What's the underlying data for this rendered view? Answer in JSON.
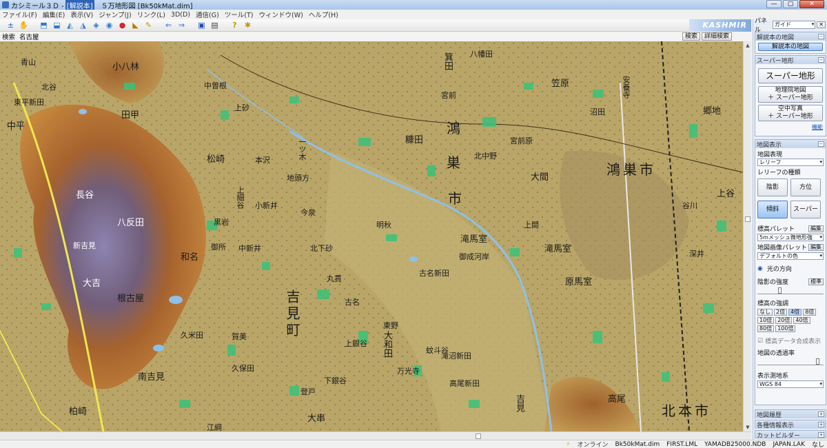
{
  "window": {
    "app_name": "カシミール３Ｄ -",
    "doc_tag": "[解説本]",
    "title_rest": "５万地形図 [Bk50kMat.dim]",
    "min": "—",
    "max": "▢",
    "close": "✕"
  },
  "menu": [
    "ファイル(F)",
    "編集(E)",
    "表示(V)",
    "ジャンプ(J)",
    "リンク(L)",
    "3D(D)",
    "通信(G)",
    "ツール(T)",
    "ウィンドウ(W)",
    "ヘルプ(H)"
  ],
  "toolbar": {
    "icons": [
      "jump-icon",
      "hand-icon",
      "open-icon",
      "save-icon",
      "map-a-icon",
      "map-b-icon",
      "map-c-icon",
      "map-d-icon",
      "pin-icon",
      "ruler-icon",
      "pencil-icon",
      "back-arrow-icon",
      "forward-arrow-icon",
      "gps-icon",
      "phone-icon",
      "help-icon",
      "star-icon"
    ],
    "glyphs": [
      "±",
      "✋",
      "⬒",
      "⬓",
      "◭",
      "◮",
      "◈",
      "◉",
      "●",
      "◣",
      "✎",
      "⇐",
      "⇒",
      "▣",
      "▤",
      "?",
      "✱"
    ],
    "brand": "KASHMIR 3D"
  },
  "search": {
    "label": "検索",
    "value": "名古屋",
    "button": "検索",
    "detail_button": "詳細検索"
  },
  "map": {
    "labels": [
      {
        "t": "青山",
        "c": "ml-sm"
      },
      {
        "t": "北谷",
        "c": "ml-sm"
      },
      {
        "t": "東平新田",
        "c": "ml-sm"
      },
      {
        "t": "中平",
        "c": "ml-md"
      },
      {
        "t": "小八林",
        "c": "ml-md"
      },
      {
        "t": "田甲",
        "c": "ml-md"
      },
      {
        "t": "松崎",
        "c": "ml-md"
      },
      {
        "t": "中曽根",
        "c": "ml-sm"
      },
      {
        "t": "上砂",
        "c": "ml-sm"
      },
      {
        "t": "本沢",
        "c": "ml-sm"
      },
      {
        "t": "一ツ木",
        "c": "ml-vert"
      },
      {
        "t": "地頭方",
        "c": "ml-sm"
      },
      {
        "t": "長谷",
        "c": "ml-md"
      },
      {
        "t": "八反田",
        "c": "ml-md"
      },
      {
        "t": "新吉見",
        "c": "ml-sm"
      },
      {
        "t": "上細谷",
        "c": "ml-vert"
      },
      {
        "t": "黒岩",
        "c": "ml-sm"
      },
      {
        "t": "小新井",
        "c": "ml-sm"
      },
      {
        "t": "今泉",
        "c": "ml-sm"
      },
      {
        "t": "御所",
        "c": "ml-sm"
      },
      {
        "t": "中新井",
        "c": "ml-sm"
      },
      {
        "t": "北下砂",
        "c": "ml-sm"
      },
      {
        "t": "吉見町",
        "c": "ml-lg"
      },
      {
        "t": "丸貫",
        "c": "ml-sm"
      },
      {
        "t": "明秋",
        "c": "ml-sm"
      },
      {
        "t": "滝馬室",
        "c": "ml-md"
      },
      {
        "t": "御成河岸",
        "c": "ml-sm"
      },
      {
        "t": "古名新田",
        "c": "ml-sm"
      },
      {
        "t": "和名",
        "c": "ml-md"
      },
      {
        "t": "大吉",
        "c": "ml-md"
      },
      {
        "t": "根古屋",
        "c": "ml-md"
      },
      {
        "t": "久米田",
        "c": "ml-sm"
      },
      {
        "t": "賀美",
        "c": "ml-sm"
      },
      {
        "t": "古名",
        "c": "ml-sm"
      },
      {
        "t": "東野",
        "c": "ml-sm"
      },
      {
        "t": "大和田",
        "c": "ml-md"
      },
      {
        "t": "上銀谷",
        "c": "ml-sm"
      },
      {
        "t": "下銀谷",
        "c": "ml-sm"
      },
      {
        "t": "久保田",
        "c": "ml-sm"
      },
      {
        "t": "南吉見",
        "c": "ml-md"
      },
      {
        "t": "江綱",
        "c": "ml-sm"
      },
      {
        "t": "柏崎",
        "c": "ml-md"
      },
      {
        "t": "蚊斗谷",
        "c": "ml-sm"
      },
      {
        "t": "万光寺",
        "c": "ml-sm"
      },
      {
        "t": "滝沼新田",
        "c": "ml-sm"
      },
      {
        "t": "高尾新田",
        "c": "ml-sm"
      },
      {
        "t": "吉見",
        "c": "ml-md"
      },
      {
        "t": "箕田",
        "c": "ml-md"
      },
      {
        "t": "糠田",
        "c": "ml-md"
      },
      {
        "t": "鴻",
        "c": "ml-lg"
      },
      {
        "t": "巣",
        "c": "ml-lg"
      },
      {
        "t": "市",
        "c": "ml-lg"
      },
      {
        "t": "宮前",
        "c": "ml-sm"
      },
      {
        "t": "八幡田",
        "c": "ml-sm"
      },
      {
        "t": "北中野",
        "c": "ml-sm"
      },
      {
        "t": "宮前原",
        "c": "ml-sm"
      },
      {
        "t": "大間",
        "c": "ml-md"
      },
      {
        "t": "上間",
        "c": "ml-sm"
      },
      {
        "t": "滝馬室",
        "c": "ml-md"
      },
      {
        "t": "原馬室",
        "c": "ml-md"
      },
      {
        "t": "鴻巣市",
        "c": "ml-lg"
      },
      {
        "t": "上谷",
        "c": "ml-md"
      },
      {
        "t": "谷川",
        "c": "ml-sm"
      },
      {
        "t": "深井",
        "c": "ml-sm"
      },
      {
        "t": "高尾",
        "c": "ml-md"
      },
      {
        "t": "北本市",
        "c": "ml-lg"
      },
      {
        "t": "郷地",
        "c": "ml-md"
      },
      {
        "t": "安養寺",
        "c": "ml-sm"
      },
      {
        "t": "笠原",
        "c": "ml-md"
      },
      {
        "t": "沼田",
        "c": "ml-sm"
      },
      {
        "t": "登戸",
        "c": "ml-sm"
      },
      {
        "t": "大串",
        "c": "ml-md"
      }
    ]
  },
  "panel": {
    "label": "パネル",
    "selected": "ガイド",
    "sections": {
      "guide_title": "解説本の地図",
      "guide_btn": "解説本の地図",
      "super_title": "スーパー地形",
      "super_btn": "スーパー地形",
      "gsi_btn_1": "地理院地図",
      "gsi_btn_2": "＋ スーパー地形",
      "photo_btn_1": "空中写真",
      "photo_btn_2": "＋ スーパー地形",
      "help_link": "機能",
      "display_title": "地図表示",
      "map_expr": "地図表現",
      "relief": "レリーフ",
      "relief_kind": "レリーフの種類",
      "shade": "陰影",
      "direction": "方位",
      "slope": "傾斜",
      "super": "スーパー",
      "elev_palette": "標高パレット",
      "edit": "編集",
      "elev_palette_val": "5mメッシュ微地形強",
      "img_palette": "地図画像パレット",
      "img_palette_val": "デフォルトの色",
      "light_dir": "光の方向",
      "shade_strength": "陰影の強度",
      "standard": "標準",
      "elev_exag": "標高の強調",
      "exag": [
        "なし",
        "2倍",
        "4倍",
        "8倍",
        "10倍",
        "20倍",
        "40倍",
        "80倍",
        "100倍"
      ],
      "synth_chk": "標高データ合成表示",
      "opacity": "地図の透過率",
      "datum_title": "表示測地系",
      "datum_val": "WGS 84",
      "history": "地図履歴",
      "info": "各種情報表示",
      "cut": "カットビルダー"
    }
  },
  "status": {
    "bolt": "⚡",
    "online": "オンライン",
    "files": [
      "Bk50kMat.dim",
      "FIRST.LML",
      "YAMADB25000.NDB",
      "JAPAN.LAK",
      "なし"
    ]
  },
  "colors": {
    "map_base": "#b9a567",
    "forest": "#3ac27a",
    "mountain_brown": "#b06a2a",
    "peak_purple": "#8a82b5",
    "river_blue": "#8fc0e8",
    "accent": "#2d63b8"
  }
}
